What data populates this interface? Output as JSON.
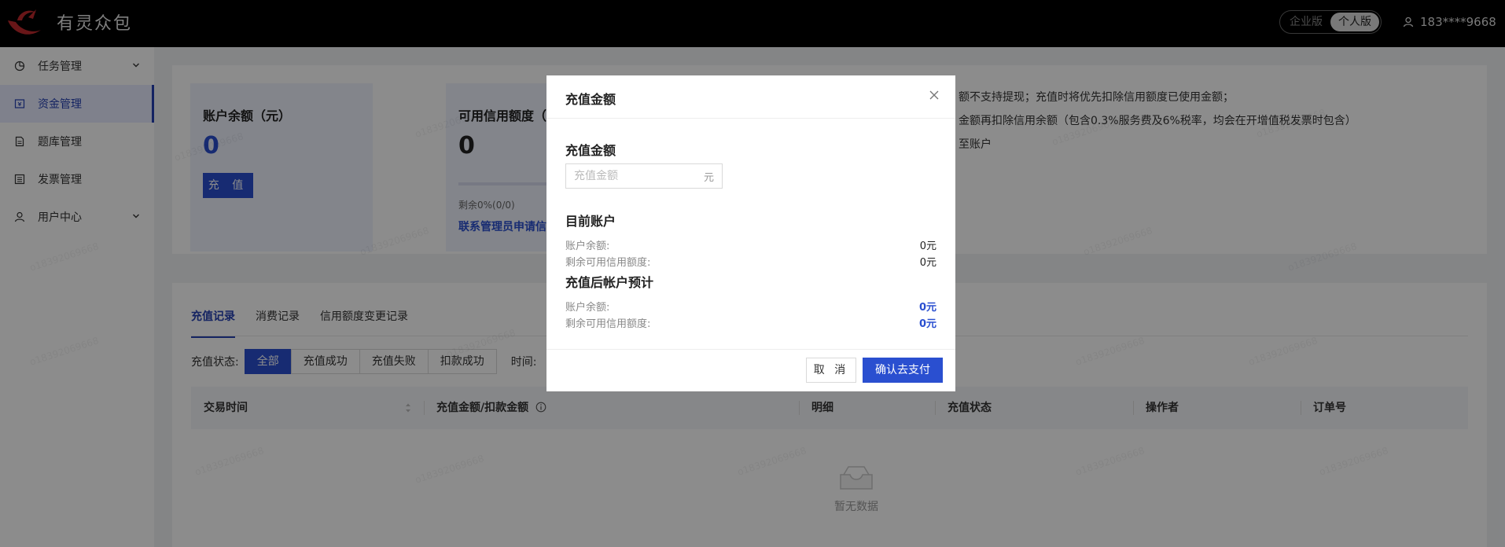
{
  "app": {
    "logo_text": "有灵众包"
  },
  "header": {
    "version_options": [
      "企业版",
      "个人版"
    ],
    "active_version": "个人版",
    "user_phone": "183****9668"
  },
  "sidebar": {
    "items": [
      {
        "label": "任务管理",
        "icon": "pie-chart-icon",
        "expandable": true,
        "active": false
      },
      {
        "label": "资金管理",
        "icon": "wallet-icon",
        "expandable": false,
        "active": true
      },
      {
        "label": "题库管理",
        "icon": "document-icon",
        "expandable": false,
        "active": false
      },
      {
        "label": "发票管理",
        "icon": "list-icon",
        "expandable": false,
        "active": false
      },
      {
        "label": "用户中心",
        "icon": "user-icon",
        "expandable": true,
        "active": false
      }
    ]
  },
  "summary": {
    "balance_title": "账户余额（元）",
    "balance_value": "0",
    "recharge_label": "充 值",
    "credit_title": "可用信用额度（",
    "credit_value": "0",
    "credit_remain": "剩余0%(0/0)",
    "credit_link": "联系管理员申请信",
    "notes": [
      "额不支持提现；充值时将优先扣除信用额度已使用金额；",
      "金额再扣除信用余额（包含0.3%服务费及6%税率，均会在开增值税发票时包含）",
      "至账户"
    ]
  },
  "records": {
    "tabs": [
      "充值记录",
      "消费记录",
      "信用额度变更记录"
    ],
    "active_tab": 0,
    "filter_label": "充值状态:",
    "filter_options": [
      "全部",
      "充值成功",
      "充值失败",
      "扣款成功"
    ],
    "filter_active": 0,
    "time_label": "时间:",
    "columns": [
      "交易时间",
      "充值金额/扣款金额",
      "明细",
      "充值状态",
      "操作者",
      "订单号"
    ],
    "empty_text": "暂无数据"
  },
  "watermark_text": "o18392069668",
  "modal": {
    "title": "充值金额",
    "amount_section": "充值金额",
    "amount_placeholder": "充值金额",
    "amount_unit": "元",
    "current_section": "目前账户",
    "current_rows": [
      {
        "label": "账户余额:",
        "value": "0元"
      },
      {
        "label": "剩余可用信用额度:",
        "value": "0元"
      }
    ],
    "after_section": "充值后帐户预计",
    "after_rows": [
      {
        "label": "账户余额:",
        "value": "0元"
      },
      {
        "label": "剩余可用信用额度:",
        "value": "0元"
      }
    ],
    "cancel_label": "取 消",
    "confirm_label": "确认去支付"
  },
  "colors": {
    "primary": "#2a4fd0",
    "topbar": "#000000"
  }
}
